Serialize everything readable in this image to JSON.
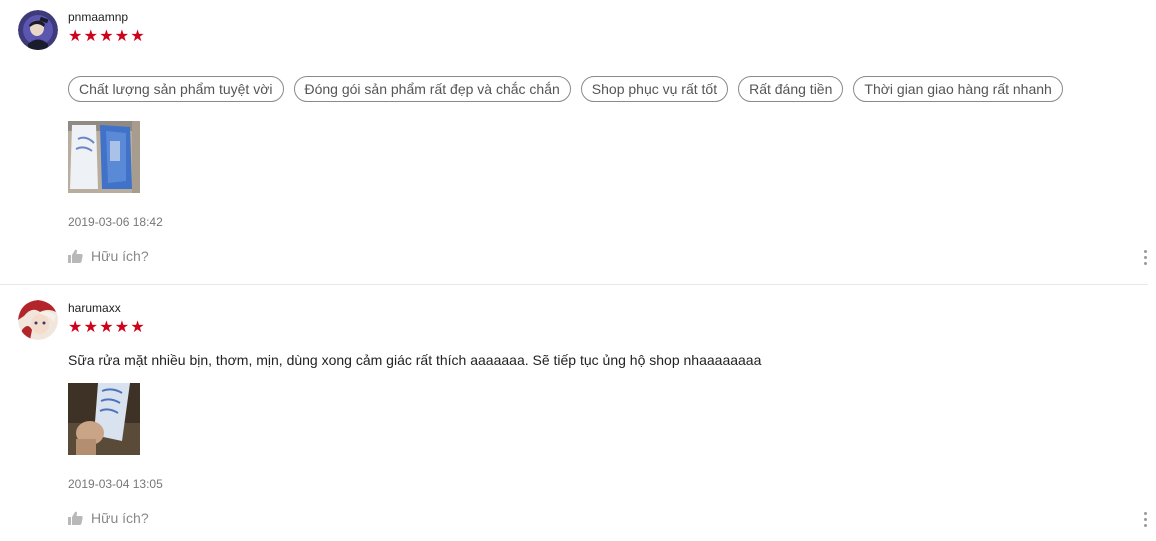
{
  "reviews": [
    {
      "username": "pnmaamnp",
      "stars": [
        "★",
        "★",
        "★",
        "★",
        "★"
      ],
      "rating": 5,
      "tags": [
        "Chất lượng sản phẩm tuyệt vời",
        "Đóng gói sản phẩm rất đẹp và chắc chắn",
        "Shop phục vụ rất tốt",
        "Rất đáng tiền",
        "Thời gian giao hàng rất nhanh"
      ],
      "timestamp": "2019-03-06 18:42",
      "helpful_label": "Hữu ích?"
    },
    {
      "username": "harumaxx",
      "stars": [
        "★",
        "★",
        "★",
        "★",
        "★"
      ],
      "rating": 5,
      "comment": "Sữa rửa mặt nhiều bịn, thơm, mịn, dùng xong cảm giác rất thích aaaaaaa. Sẽ tiếp tục ủng hộ shop nhaaaaaaaa",
      "timestamp": "2019-03-04 13:05",
      "helpful_label": "Hữu ích?"
    }
  ],
  "colors": {
    "star": "#d0011b",
    "tag_border": "#8a8a8a",
    "muted_text": "#888888"
  },
  "icons": {
    "like": "thumbs-up-icon",
    "more": "more-vertical-icon"
  }
}
